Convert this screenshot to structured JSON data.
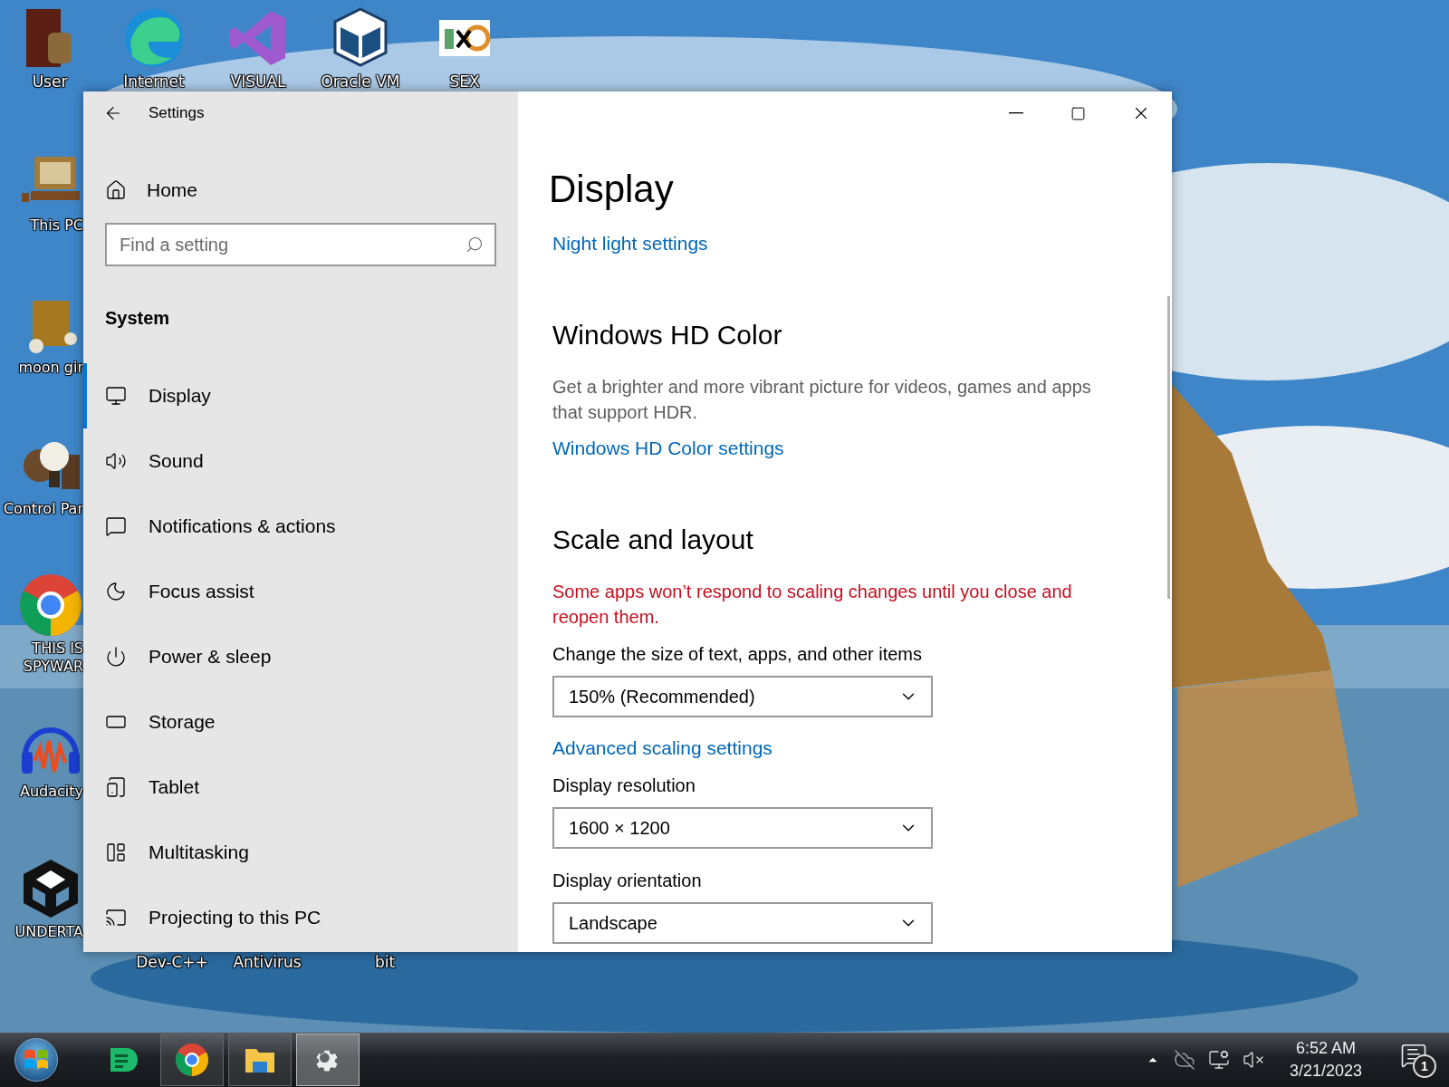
{
  "desktop": {
    "top_icons": [
      {
        "label": "User",
        "kind": "folder"
      },
      {
        "label": "Internet",
        "kind": "edge"
      },
      {
        "label": "VISUAL",
        "kind": "vs"
      },
      {
        "label": "Oracle VM",
        "kind": "vbox"
      },
      {
        "label": "SEX",
        "kind": "hxd"
      }
    ],
    "side_icons": [
      {
        "label": "This PC",
        "kind": "pc"
      },
      {
        "label": "moon gir",
        "kind": "crate"
      },
      {
        "label": "Control Par",
        "kind": "bulb"
      },
      {
        "label": "THIS IS SPYWAR",
        "kind": "chrome"
      },
      {
        "label": "Audacity",
        "kind": "audio"
      },
      {
        "label": "UNDERTA",
        "kind": "unity"
      }
    ],
    "bottom_labels": [
      "Dev-C++",
      "Antivirus",
      "bit"
    ]
  },
  "window": {
    "title": "Settings",
    "sidebar": {
      "home": "Home",
      "search": {
        "placeholder": "Find a setting"
      },
      "section": "System",
      "items": [
        {
          "label": "Display",
          "kind": "monitor",
          "selected": true
        },
        {
          "label": "Sound",
          "kind": "speaker",
          "selected": false
        },
        {
          "label": "Notifications & actions",
          "kind": "message",
          "selected": false
        },
        {
          "label": "Focus assist",
          "kind": "moon",
          "selected": false
        },
        {
          "label": "Power & sleep",
          "kind": "power",
          "selected": false
        },
        {
          "label": "Storage",
          "kind": "storage",
          "selected": false
        },
        {
          "label": "Tablet",
          "kind": "tablet",
          "selected": false
        },
        {
          "label": "Multitasking",
          "kind": "multitask",
          "selected": false
        },
        {
          "label": "Projecting to this PC",
          "kind": "project",
          "selected": false
        }
      ]
    },
    "content": {
      "title": "Display",
      "blocks": [
        {
          "kind": "link",
          "text": "Night light settings"
        },
        {
          "kind": "heading",
          "text": "Windows HD Color"
        },
        {
          "kind": "paragraph",
          "text": "Get a brighter and more vibrant picture for videos, games and apps that support HDR."
        },
        {
          "kind": "link",
          "text": "Windows HD Color settings"
        },
        {
          "kind": "heading",
          "text": "Scale and layout"
        },
        {
          "kind": "warning",
          "text": "Some apps won’t respond to scaling changes until you close and reopen them."
        },
        {
          "kind": "label",
          "text": "Change the size of text, apps, and other items"
        },
        {
          "kind": "dropdown",
          "value": "150% (Recommended)"
        },
        {
          "kind": "link",
          "text": "Advanced scaling settings"
        },
        {
          "kind": "label",
          "text": "Display resolution"
        },
        {
          "kind": "dropdown",
          "value": "1600 × 1200"
        },
        {
          "kind": "label",
          "text": "Display orientation"
        },
        {
          "kind": "dropdown",
          "value": "Landscape"
        }
      ]
    }
  },
  "taskbar": {
    "apps": [
      {
        "kind": "notes",
        "running": false,
        "selected": false
      },
      {
        "kind": "chrome",
        "running": true,
        "selected": false
      },
      {
        "kind": "explorer",
        "running": true,
        "selected": false
      },
      {
        "kind": "settings",
        "running": true,
        "selected": true
      }
    ],
    "time": "6:52 AM",
    "date": "3/21/2023",
    "notifications": "1"
  }
}
